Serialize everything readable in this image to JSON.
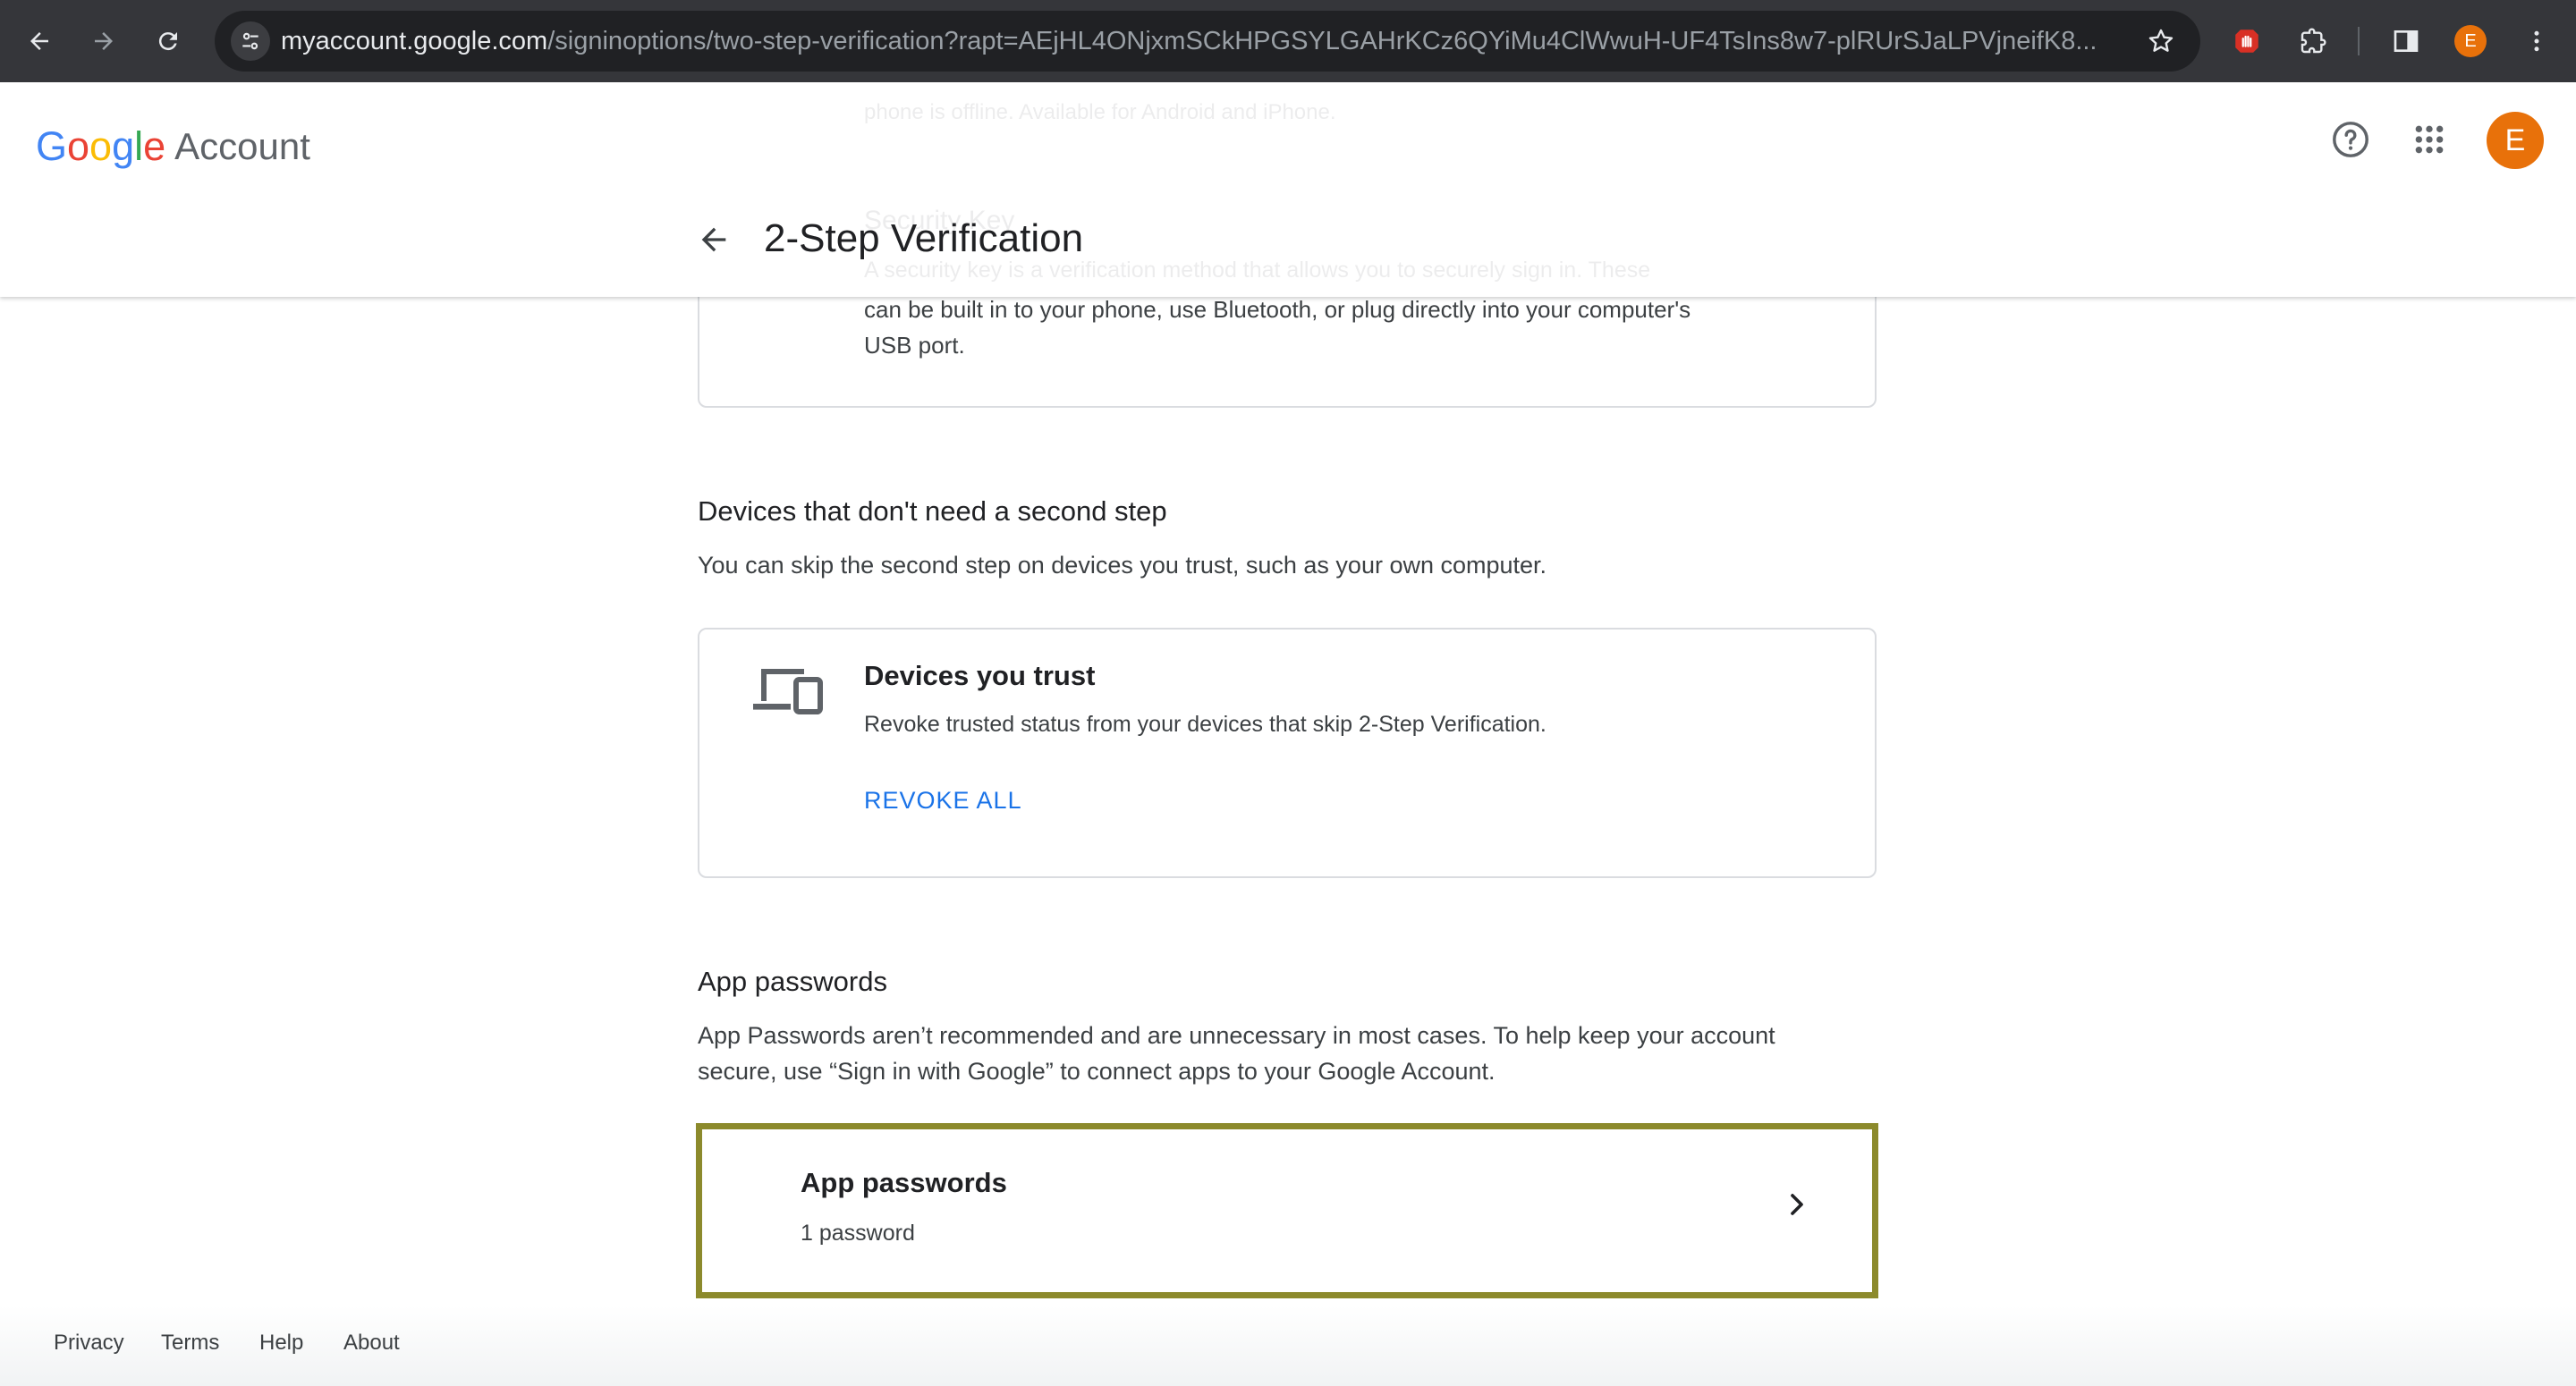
{
  "browser": {
    "url_host": "myaccount.google.com",
    "url_path": "/signinoptions/two-step-verification?rapt=AEjHL4ONjxmSCkHPGSYLGAHrKCz6QYiMu4ClWwuH-UF4TsIns8w7-plRUrSJaLPVjneifK8...",
    "profile_initial": "E"
  },
  "header": {
    "logo_google": [
      "G",
      "o",
      "o",
      "g",
      "l",
      "e"
    ],
    "logo_colors": [
      "#4285F4",
      "#EA4335",
      "#FBBC05",
      "#4285F4",
      "#34A853",
      "#EA4335"
    ],
    "logo_account": "Account",
    "title": "2-Step Verification",
    "avatar_initial": "E"
  },
  "ghost": {
    "line1": "phone is offline. Available for Android and iPhone.",
    "line2": "Security Key",
    "line3": "A security key is a verification method that allows you to securely sign in. These"
  },
  "security_key_card": {
    "line_a": "can be built in to your phone, use Bluetooth, or plug directly into your computer's",
    "line_b": "USB port."
  },
  "devices_section": {
    "title": "Devices that don't need a second step",
    "description": "You can skip the second step on devices you trust, such as your own computer.",
    "card_title": "Devices you trust",
    "card_description": "Revoke trusted status from your devices that skip 2-Step Verification.",
    "action": "REVOKE ALL"
  },
  "app_passwords_section": {
    "title": "App passwords",
    "description_line1": "App Passwords aren’t recommended and are unnecessary in most cases. To help keep your account",
    "description_line2": "secure, use “Sign in with Google” to connect apps to your Google Account.",
    "card_title": "App passwords",
    "card_subtitle": "1 password"
  },
  "footer": {
    "privacy": "Privacy",
    "terms": "Terms",
    "help": "Help",
    "about": "About"
  },
  "colors": {
    "accent": "#1a73e8",
    "highlight_border": "#8c8a2c",
    "avatar": "#e8710a"
  }
}
